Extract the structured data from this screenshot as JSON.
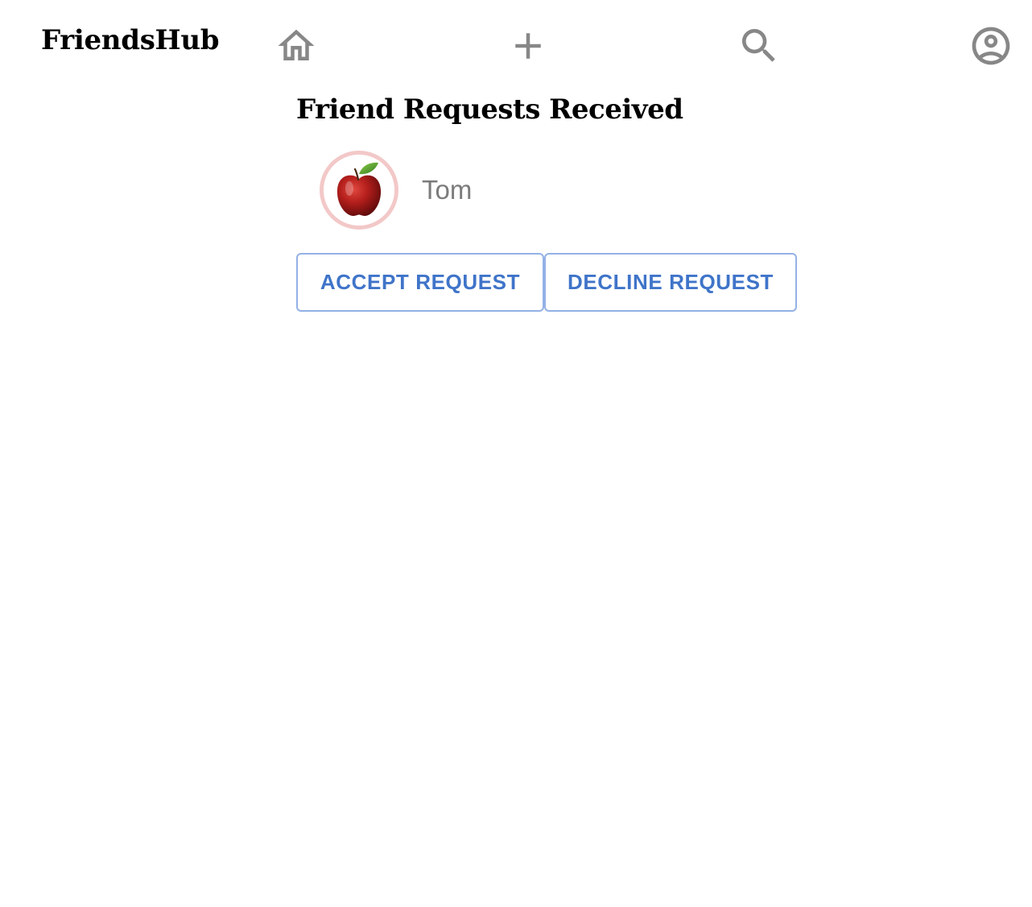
{
  "app": {
    "brand": "FriendsHub"
  },
  "nav": {
    "icons": [
      "home-icon",
      "add-icon",
      "search-icon",
      "account-circle-icon"
    ]
  },
  "requests": {
    "title": "Friend Requests Received",
    "items": [
      {
        "name": "Tom",
        "avatar": "apple-photo",
        "accept_label": "ACCEPT REQUEST",
        "decline_label": "DECLINE REQUEST"
      }
    ]
  },
  "colors": {
    "icon_gray": "#878787",
    "button_text": "#3f74c9",
    "button_border": "#93b1e6",
    "avatar_ring": "#f3c8c8",
    "name_text": "#7b7b7b"
  }
}
